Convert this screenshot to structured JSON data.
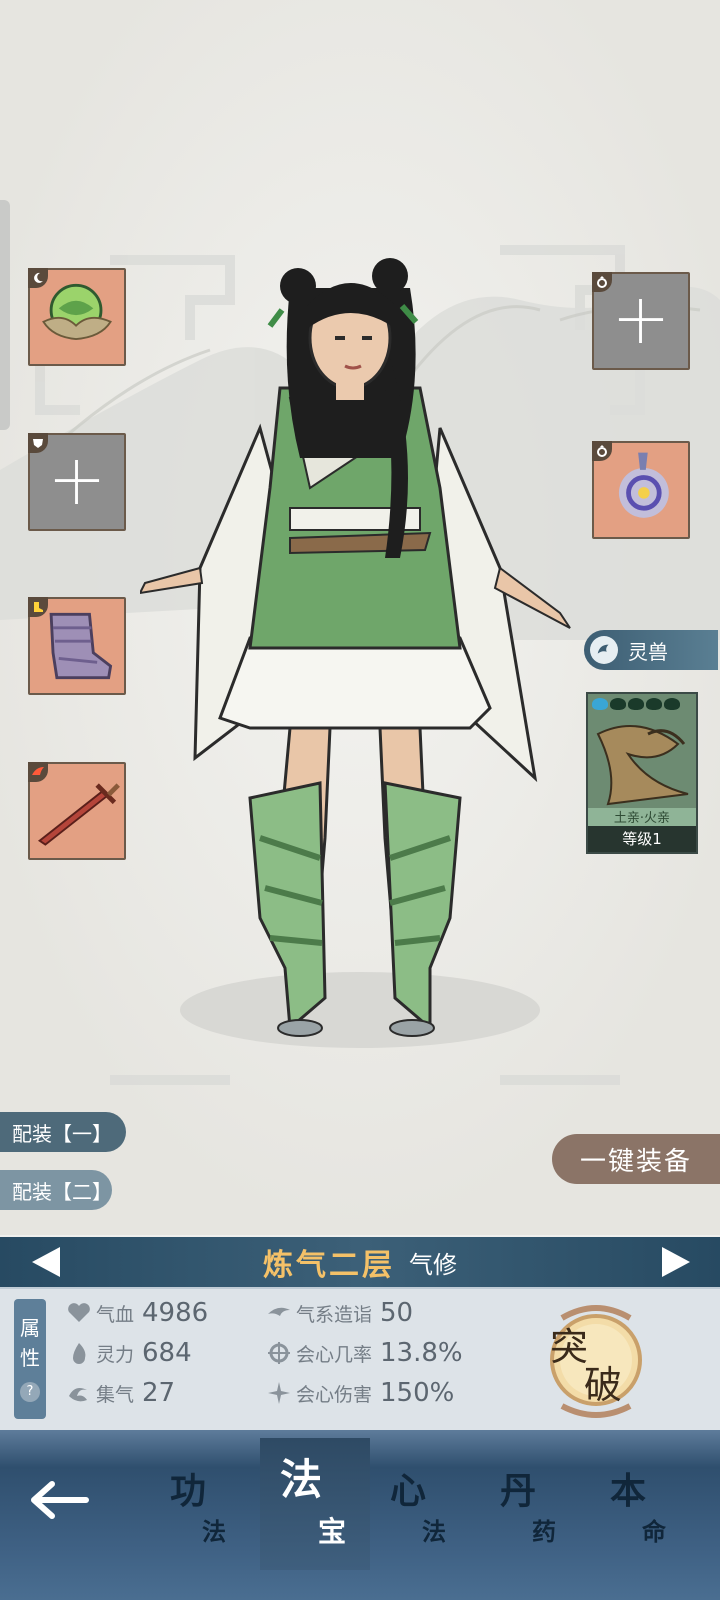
{
  "equipment": {
    "left_slots": [
      {
        "name": "green-orb-treasure",
        "state": "filled"
      },
      {
        "name": "empty-slot",
        "state": "empty"
      },
      {
        "name": "purple-boots",
        "state": "filled"
      },
      {
        "name": "red-sword",
        "state": "filled"
      }
    ],
    "right_slots": [
      {
        "name": "empty-slot",
        "state": "empty"
      },
      {
        "name": "spirit-ring",
        "state": "filled"
      }
    ]
  },
  "beast": {
    "tab_label": "灵兽",
    "affinity": "土亲·火亲",
    "level": "等级1"
  },
  "loadouts": {
    "one": "配装【一】",
    "two": "配装【二】"
  },
  "equip_all_label": "一键装备",
  "realm": {
    "name": "炼气二层",
    "type": "气修"
  },
  "stats_tab": {
    "label_top": "属",
    "label_bottom": "性",
    "help": "?"
  },
  "stats": [
    {
      "label": "气血",
      "value": "4986",
      "icon": "heart-icon"
    },
    {
      "label": "灵力",
      "value": "684",
      "icon": "flame-icon"
    },
    {
      "label": "集气",
      "value": "27",
      "icon": "swirl-icon"
    },
    {
      "label": "气系造诣",
      "value": "50",
      "icon": "wind-icon"
    },
    {
      "label": "会心几率",
      "value": "13.8%",
      "icon": "crit-rate-icon"
    },
    {
      "label": "会心伤害",
      "value": "150%",
      "icon": "crit-damage-icon"
    }
  ],
  "breakthrough": {
    "top": "突",
    "bottom": "破"
  },
  "tabs": [
    {
      "big": "功",
      "small": "法",
      "active": false
    },
    {
      "big": "法",
      "small": "宝",
      "active": true
    },
    {
      "big": "心",
      "small": "法",
      "active": false
    },
    {
      "big": "丹",
      "small": "药",
      "active": false
    },
    {
      "big": "本",
      "small": "命",
      "active": false
    }
  ],
  "colors": {
    "realm_gold": "#f4c168",
    "realm_bar": "#274a62",
    "tab_bar": "#3f6184",
    "slot_orange": "#e3a083",
    "slot_gray": "#8e8e8e"
  }
}
